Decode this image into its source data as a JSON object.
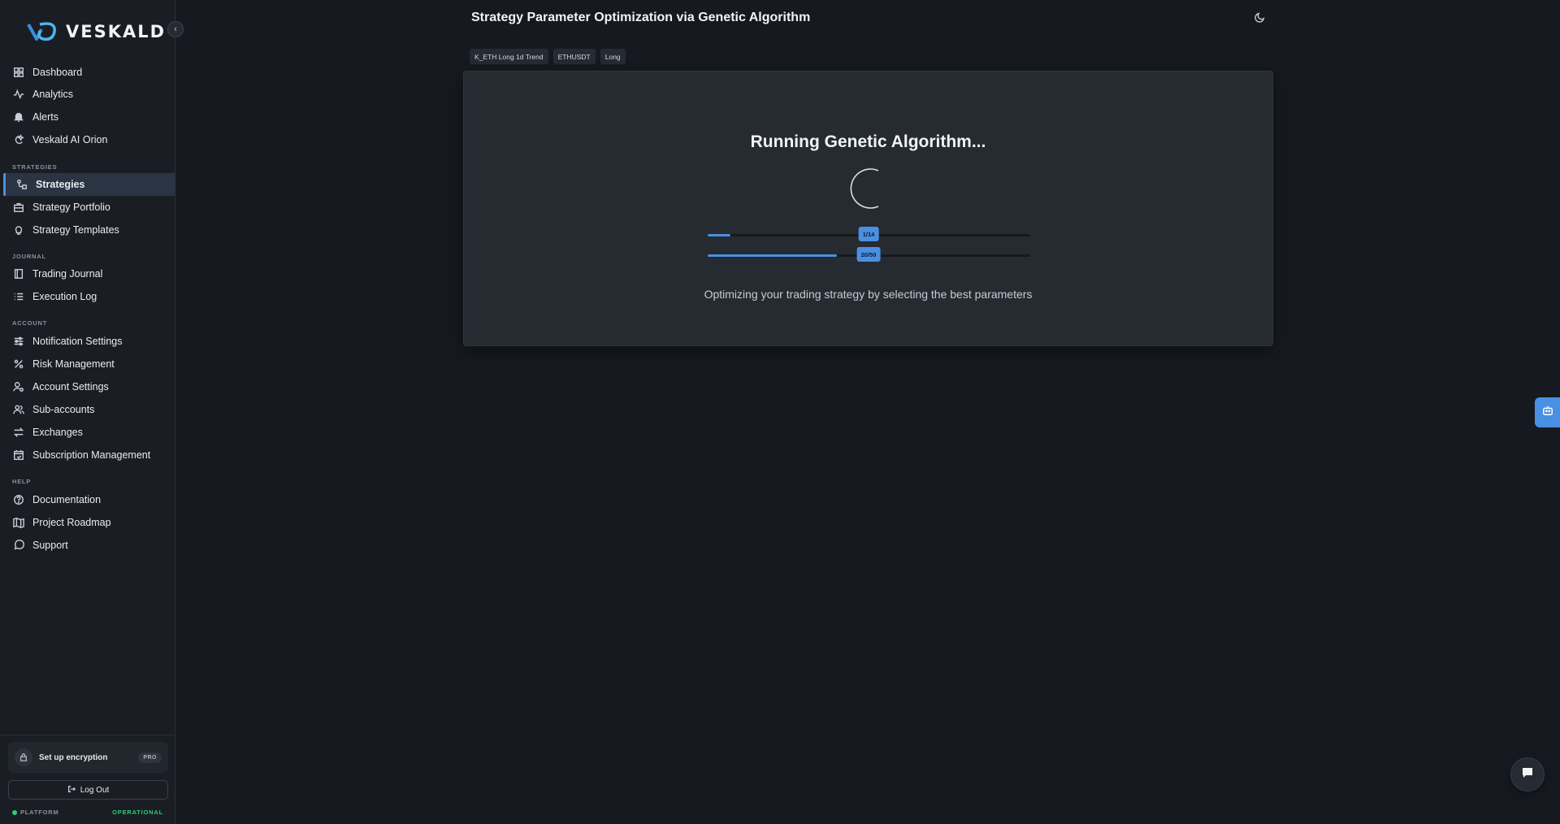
{
  "brand": {
    "name": "VESKALD"
  },
  "sidebar": {
    "sections": {
      "strategies": "STRATEGIES",
      "journal": "JOURNAL",
      "account": "ACCOUNT",
      "help": "HELP"
    },
    "items": [
      {
        "label": "Dashboard",
        "icon": "dashboard-icon"
      },
      {
        "label": "Analytics",
        "icon": "activity-icon"
      },
      {
        "label": "Alerts",
        "icon": "bell-icon"
      },
      {
        "label": "Veskald AI Orion",
        "icon": "ai-orion-icon"
      },
      {
        "label": "Strategies",
        "icon": "strategies-icon",
        "active": true
      },
      {
        "label": "Strategy Portfolio",
        "icon": "briefcase-icon"
      },
      {
        "label": "Strategy Templates",
        "icon": "lightbulb-icon"
      },
      {
        "label": "Trading Journal",
        "icon": "notebook-icon"
      },
      {
        "label": "Execution Log",
        "icon": "list-icon"
      },
      {
        "label": "Notification Settings",
        "icon": "sliders-icon"
      },
      {
        "label": "Risk Management",
        "icon": "percent-icon"
      },
      {
        "label": "Account Settings",
        "icon": "user-cog-icon"
      },
      {
        "label": "Sub-accounts",
        "icon": "users-icon"
      },
      {
        "label": "Exchanges",
        "icon": "exchange-arrows-icon"
      },
      {
        "label": "Subscription Management",
        "icon": "calendar-check-icon"
      },
      {
        "label": "Documentation",
        "icon": "help-circle-icon"
      },
      {
        "label": "Project Roadmap",
        "icon": "map-icon"
      },
      {
        "label": "Support",
        "icon": "message-circle-icon"
      }
    ],
    "encryption": {
      "label": "Set up encryption",
      "badge": "PRO"
    },
    "logout_label": "Log Out",
    "status": {
      "label": "PLATFORM",
      "value": "OPERATIONAL"
    }
  },
  "header": {
    "title": "Strategy Parameter Optimization via Genetic Algorithm"
  },
  "tags": [
    "K_ETH Long 1d Trend",
    "ETHUSDT",
    "Long"
  ],
  "optimization": {
    "title": "Running Genetic Algorithm...",
    "progress_1": {
      "label": "1/14",
      "fraction": 0.0714
    },
    "progress_2": {
      "label": "20/50",
      "fraction": 0.4
    },
    "subtitle": "Optimizing your trading strategy by selecting the best parameters"
  },
  "colors": {
    "accent": "#4a90e2",
    "background": "#161a20",
    "sidebar": "#1a1e24",
    "card": "#262a31",
    "operational": "#2ecc71"
  }
}
